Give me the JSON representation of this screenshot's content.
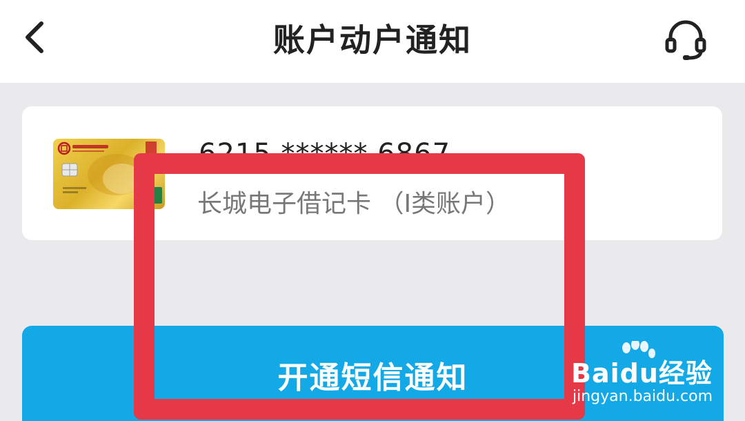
{
  "header": {
    "title": "账户动户通知",
    "back_icon": "chevron-left-icon",
    "support_icon": "headset-icon"
  },
  "account": {
    "number": "6215 ****** 6867",
    "name": "长城电子借记卡 （I类账户）"
  },
  "action": {
    "sms_label": "开通短信通知"
  },
  "watermark": {
    "logo": "Baidu经验",
    "url": "jingyan.baidu.com"
  },
  "colors": {
    "primary_button": "#13a8e6",
    "highlight_border": "#e53948",
    "background": "#eaeaed"
  }
}
